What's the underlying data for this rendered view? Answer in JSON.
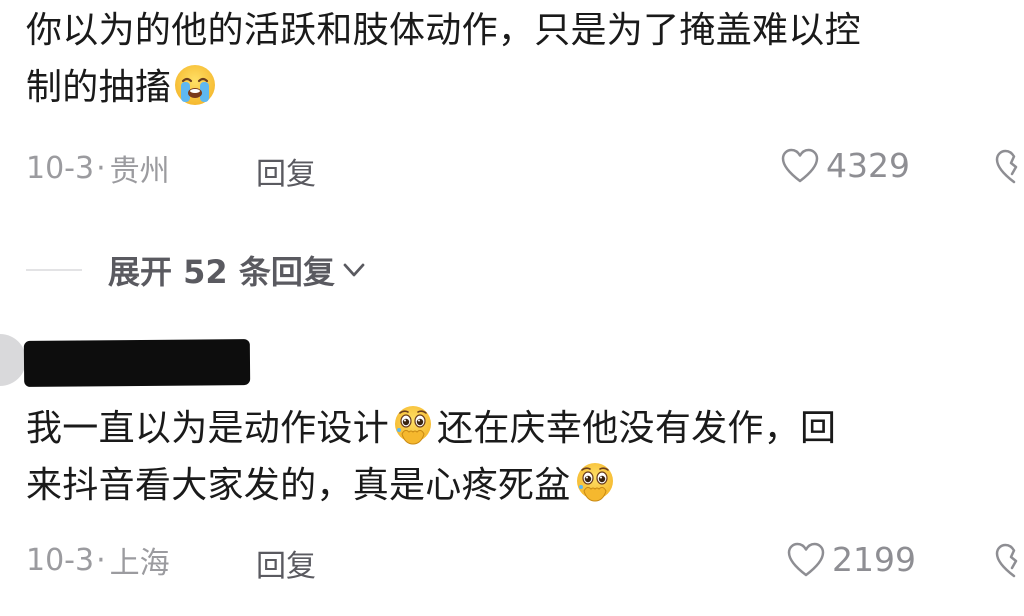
{
  "comments": [
    {
      "text_line1": "你以为的他的活跃和肢体动作，只是为了掩盖难以控",
      "text_line2": "制的抽搐",
      "emoji": "loudly-crying-emoji",
      "date": "10-3",
      "dot": "·",
      "location": "贵州",
      "reply_label": "回复",
      "likes": "4329"
    },
    {
      "author_redacted": true,
      "text_line1_a": "我一直以为是动作设计",
      "emoji1": "holding-back-tears-emoji",
      "text_line1_b": "还在庆幸他没有发作，回",
      "text_line2": "来抖音看大家发的，真是心疼死盆",
      "emoji2": "holding-back-tears-emoji",
      "date": "10-3",
      "dot": "·",
      "location": "上海",
      "reply_label": "回复",
      "likes": "2199"
    }
  ],
  "expand_replies": {
    "label": "展开 52 条回复"
  },
  "icons": {
    "like": "heart-outline-icon",
    "dislike": "broken-heart-icon",
    "expand": "chevron-down-icon"
  },
  "colors": {
    "text": "#1a1a1a",
    "meta": "#9b9b9f",
    "reply": "#5a5a60",
    "like_icon": "#8e8e93",
    "emoji_face": "#ffcc33"
  }
}
